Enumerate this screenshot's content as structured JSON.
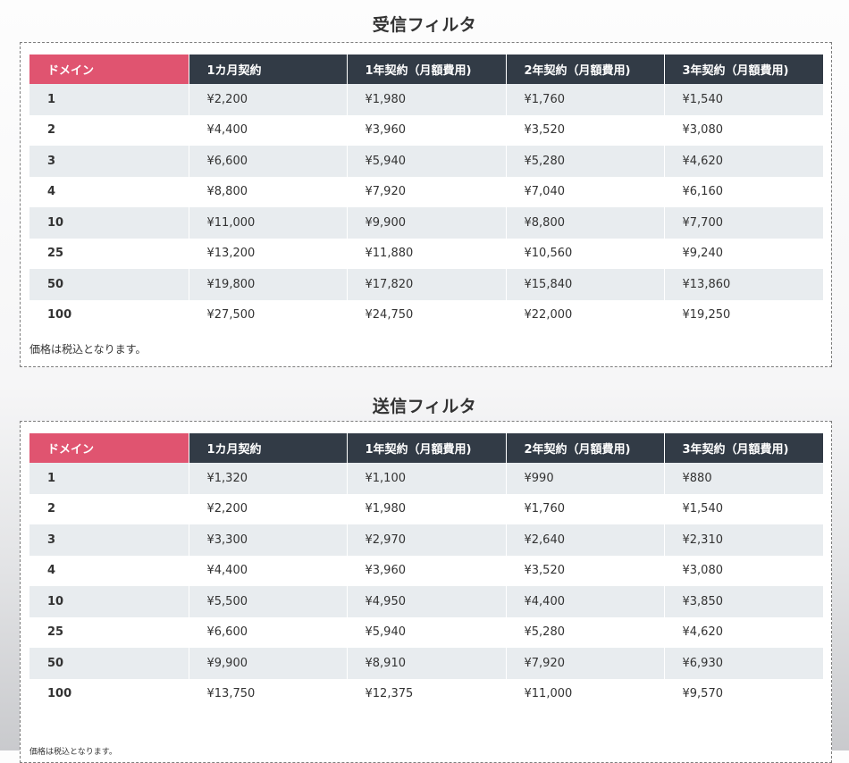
{
  "columns": [
    "ドメイン",
    "1カ月契約",
    "1年契約（月額費用)",
    "2年契約（月額費用)",
    "3年契約（月額費用)"
  ],
  "receive_filter": {
    "title": "受信フィルタ",
    "rows": [
      [
        "1",
        "¥2,200",
        "¥1,980",
        "¥1,760",
        "¥1,540"
      ],
      [
        "2",
        "¥4,400",
        "¥3,960",
        "¥3,520",
        "¥3,080"
      ],
      [
        "3",
        "¥6,600",
        "¥5,940",
        "¥5,280",
        "¥4,620"
      ],
      [
        "4",
        "¥8,800",
        "¥7,920",
        "¥7,040",
        "¥6,160"
      ],
      [
        "10",
        "¥11,000",
        "¥9,900",
        "¥8,800",
        "¥7,700"
      ],
      [
        "25",
        "¥13,200",
        "¥11,880",
        "¥10,560",
        "¥9,240"
      ],
      [
        "50",
        "¥19,800",
        "¥17,820",
        "¥15,840",
        "¥13,860"
      ],
      [
        "100",
        "¥27,500",
        "¥24,750",
        "¥22,000",
        "¥19,250"
      ]
    ],
    "note": "価格は税込となります。"
  },
  "send_filter": {
    "title": "送信フィルタ",
    "rows": [
      [
        "1",
        "¥1,320",
        "¥1,100",
        "¥990",
        "¥880"
      ],
      [
        "2",
        "¥2,200",
        "¥1,980",
        "¥1,760",
        "¥1,540"
      ],
      [
        "3",
        "¥3,300",
        "¥2,970",
        "¥2,640",
        "¥2,310"
      ],
      [
        "4",
        "¥4,400",
        "¥3,960",
        "¥3,520",
        "¥3,080"
      ],
      [
        "10",
        "¥5,500",
        "¥4,950",
        "¥4,400",
        "¥3,850"
      ],
      [
        "25",
        "¥6,600",
        "¥5,940",
        "¥5,280",
        "¥4,620"
      ],
      [
        "50",
        "¥9,900",
        "¥8,910",
        "¥7,920",
        "¥6,930"
      ],
      [
        "100",
        "¥13,750",
        "¥12,375",
        "¥11,000",
        "¥9,570"
      ]
    ],
    "note": "価格は税込となります。"
  },
  "colors": {
    "domain_header": "#e05470",
    "header_dark": "#323b46",
    "row_stripe": "#e8ecef"
  }
}
